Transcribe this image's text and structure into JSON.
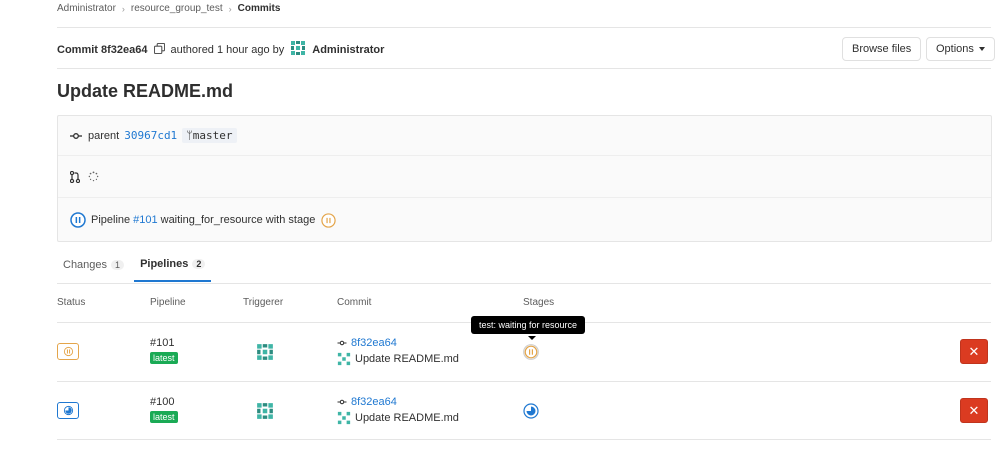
{
  "breadcrumb": {
    "items": [
      "Administrator",
      "resource_group_test"
    ],
    "current": "Commits"
  },
  "commit": {
    "label": "Commit 8f32ea64",
    "authored": "authored 1 hour ago by",
    "author": "Administrator",
    "title": "Update README.md",
    "parent_label": "parent",
    "parent_sha": "30967cd1",
    "branch": "master",
    "pipeline_prefix": "Pipeline",
    "pipeline_link": "#101",
    "pipeline_suffix": "waiting_for_resource with stage"
  },
  "header_buttons": {
    "browse": "Browse files",
    "options": "Options"
  },
  "tabs": [
    {
      "label": "Changes",
      "count": "1",
      "active": false
    },
    {
      "label": "Pipelines",
      "count": "2",
      "active": true
    }
  ],
  "table": {
    "headers": {
      "status": "Status",
      "pipeline": "Pipeline",
      "triggerer": "Triggerer",
      "commit": "Commit",
      "stages": "Stages"
    },
    "rows": [
      {
        "id": "#101",
        "badge": "latest",
        "sha": "8f32ea64",
        "message": "Update README.md",
        "status": "waiting_for_resource",
        "status_color": "#e4a54a"
      },
      {
        "id": "#100",
        "badge": "latest",
        "sha": "8f32ea64",
        "message": "Update README.md",
        "status": "running",
        "status_color": "#1f78d1"
      }
    ]
  },
  "tooltip": "test: waiting for resource",
  "colors": {
    "link": "#1f78d1",
    "success": "#1aaa55",
    "danger": "#db3b21",
    "warning": "#e4a54a"
  }
}
